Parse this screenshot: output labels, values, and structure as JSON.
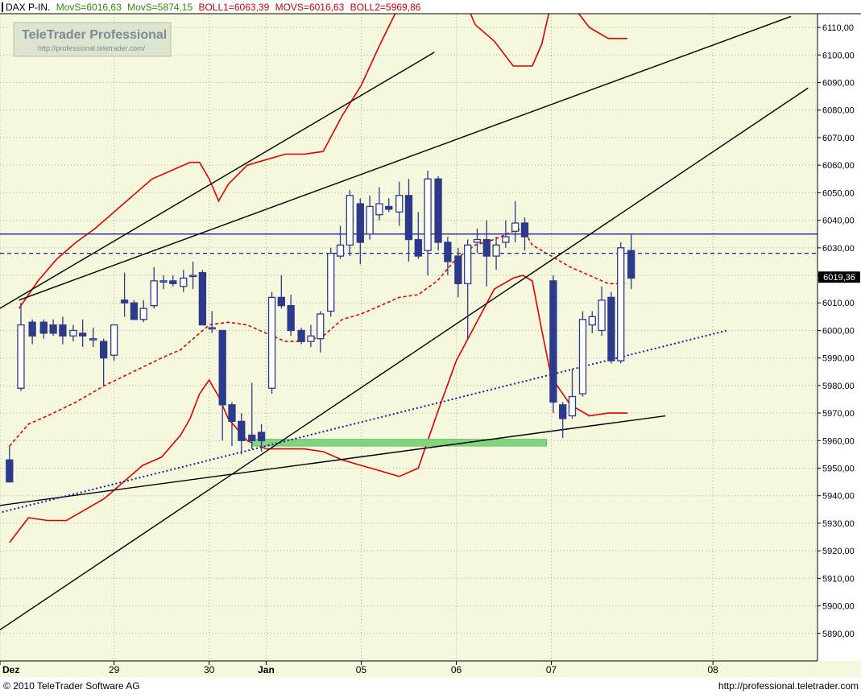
{
  "header": {
    "symbol": "DAX P-IN.",
    "movs_fast": "MovS=6016,63",
    "movs_slow": "MovS=5874,15",
    "boll1": "BOLL1=6063,39",
    "movs_mid": "MOVS=6016,63",
    "boll2": "BOLL2=5969,86"
  },
  "watermark": {
    "title": "TeleTrader Professional",
    "url": "http://professional.teletrader.com/"
  },
  "footer": {
    "copyright": "© 2010 TeleTrader Software AG",
    "url": "http://professional.teletrader.com"
  },
  "colors": {
    "background": "#f5f8dc",
    "grid": "#aab0a0",
    "candle": "#2d3a8c",
    "bollinger": "#e00000",
    "horizontal_level": "#1a1aa8",
    "support_zone": "#7fd67f",
    "trendline": "#000000",
    "title_green": "#2e8b00",
    "title_red": "#cc0000"
  },
  "chart_data": {
    "type": "candlestick",
    "y_axis": {
      "min": 5880,
      "max": 6115,
      "ticks": [
        5890,
        5900,
        5910,
        5920,
        5930,
        5940,
        5950,
        5960,
        5970,
        5980,
        5990,
        6000,
        6010,
        6020,
        6030,
        6040,
        6050,
        6060,
        6070,
        6080,
        6090,
        6100,
        6110
      ],
      "tick_labels": [
        "5890,00",
        "5900,00",
        "5910,00",
        "5920,00",
        "5930,00",
        "5940,00",
        "5950,00",
        "5960,00",
        "5970,00",
        "5980,00",
        "5990,00",
        "6000,00",
        "6010,00",
        "6020,00",
        "6030,00",
        "6040,00",
        "6050,00",
        "6060,00",
        "6070,00",
        "6080,00",
        "6090,00",
        "6100,00",
        "6110,00"
      ],
      "last_price_label": "6019,36",
      "last_price": 6019.36
    },
    "x_axis": {
      "bar_min": 0,
      "bar_max": 86,
      "ticks": [
        {
          "bar": 0,
          "label": "Dez"
        },
        {
          "bar": 12,
          "label": "29"
        },
        {
          "bar": 22,
          "label": "30"
        },
        {
          "bar": 28,
          "label": "Jan"
        },
        {
          "bar": 38,
          "label": "05"
        },
        {
          "bar": 48,
          "label": "06"
        },
        {
          "bar": 58,
          "label": "07"
        },
        {
          "bar": 75,
          "label": "08"
        }
      ]
    },
    "grid": true,
    "candles": [
      {
        "x": 1,
        "o": 5953,
        "h": 5958,
        "l": 5945,
        "c": 5945
      },
      {
        "x": 2.2,
        "o": 5979,
        "h": 6010,
        "l": 5978,
        "c": 6002
      },
      {
        "x": 3.4,
        "o": 6003,
        "h": 6004,
        "l": 5995,
        "c": 5998
      },
      {
        "x": 4.6,
        "o": 6003,
        "h": 6004,
        "l": 5997,
        "c": 5999
      },
      {
        "x": 5.6,
        "o": 6002,
        "h": 6004,
        "l": 5998,
        "c": 5999
      },
      {
        "x": 6.6,
        "o": 6002,
        "h": 6005,
        "l": 5995,
        "c": 5998
      },
      {
        "x": 7.7,
        "o": 5998,
        "h": 6002,
        "l": 5996,
        "c": 6000
      },
      {
        "x": 8.7,
        "o": 5999,
        "h": 6004,
        "l": 5994,
        "c": 5998
      },
      {
        "x": 9.8,
        "o": 5997,
        "h": 6001,
        "l": 5994,
        "c": 5997
      },
      {
        "x": 10.9,
        "o": 5996,
        "h": 5997,
        "l": 5980,
        "c": 5990
      },
      {
        "x": 12,
        "o": 5991,
        "h": 6002,
        "l": 5989,
        "c": 6002
      },
      {
        "x": 13.1,
        "o": 6011,
        "h": 6021,
        "l": 6005,
        "c": 6010
      },
      {
        "x": 14.1,
        "o": 6010,
        "h": 6011,
        "l": 6004,
        "c": 6004
      },
      {
        "x": 15.1,
        "o": 6004,
        "h": 6011,
        "l": 6003,
        "c": 6008
      },
      {
        "x": 16.2,
        "o": 6009,
        "h": 6023,
        "l": 6008,
        "c": 6018
      },
      {
        "x": 17.2,
        "o": 6018,
        "h": 6020,
        "l": 6015,
        "c": 6018
      },
      {
        "x": 18.2,
        "o": 6018,
        "h": 6020,
        "l": 6016,
        "c": 6017
      },
      {
        "x": 19.3,
        "o": 6016,
        "h": 6022,
        "l": 6014,
        "c": 6019
      },
      {
        "x": 20.3,
        "o": 6020,
        "h": 6025,
        "l": 6015,
        "c": 6020
      },
      {
        "x": 21.3,
        "o": 6021,
        "h": 6022,
        "l": 6002,
        "c": 6002
      },
      {
        "x": 22.3,
        "o": 6001,
        "h": 6007,
        "l": 5999,
        "c": 6001
      },
      {
        "x": 23.4,
        "o": 6000,
        "h": 6000,
        "l": 5960,
        "c": 5973
      },
      {
        "x": 24.4,
        "o": 5973,
        "h": 5974,
        "l": 5958,
        "c": 5967
      },
      {
        "x": 25.4,
        "o": 5967,
        "h": 5970,
        "l": 5955,
        "c": 5960
      },
      {
        "x": 26.5,
        "o": 5962,
        "h": 5981,
        "l": 5957,
        "c": 5960
      },
      {
        "x": 27.5,
        "o": 5963,
        "h": 5966,
        "l": 5956,
        "c": 5960
      },
      {
        "x": 28.6,
        "o": 5979,
        "h": 6014,
        "l": 5977,
        "c": 6012
      },
      {
        "x": 29.6,
        "o": 6012,
        "h": 6020,
        "l": 6008,
        "c": 6009
      },
      {
        "x": 30.6,
        "o": 6009,
        "h": 6013,
        "l": 5998,
        "c": 6000
      },
      {
        "x": 31.7,
        "o": 6000,
        "h": 6001,
        "l": 5995,
        "c": 5996
      },
      {
        "x": 32.7,
        "o": 5996,
        "h": 6002,
        "l": 5994,
        "c": 5998
      },
      {
        "x": 33.7,
        "o": 5997,
        "h": 6007,
        "l": 5992,
        "c": 6006
      },
      {
        "x": 34.8,
        "o": 6007,
        "h": 6030,
        "l": 6005,
        "c": 6028
      },
      {
        "x": 35.8,
        "o": 6027,
        "h": 6038,
        "l": 6026,
        "c": 6031
      },
      {
        "x": 36.8,
        "o": 6031,
        "h": 6051,
        "l": 6027,
        "c": 6049
      },
      {
        "x": 37.9,
        "o": 6046,
        "h": 6048,
        "l": 6024,
        "c": 6032
      },
      {
        "x": 38.9,
        "o": 6035,
        "h": 6049,
        "l": 6033,
        "c": 6045
      },
      {
        "x": 39.9,
        "o": 6042,
        "h": 6052,
        "l": 6040,
        "c": 6046
      },
      {
        "x": 40.9,
        "o": 6045,
        "h": 6048,
        "l": 6043,
        "c": 6044
      },
      {
        "x": 42,
        "o": 6043,
        "h": 6054,
        "l": 6038,
        "c": 6049
      },
      {
        "x": 43,
        "o": 6049,
        "h": 6055,
        "l": 6025,
        "c": 6033
      },
      {
        "x": 44,
        "o": 6033,
        "h": 6043,
        "l": 6026,
        "c": 6027
      },
      {
        "x": 45,
        "o": 6029,
        "h": 6058,
        "l": 6020,
        "c": 6055
      },
      {
        "x": 46.1,
        "o": 6055,
        "h": 6056,
        "l": 6029,
        "c": 6032
      },
      {
        "x": 47.1,
        "o": 6032,
        "h": 6034,
        "l": 6020,
        "c": 6025
      },
      {
        "x": 48.2,
        "o": 6027,
        "h": 6030,
        "l": 6012,
        "c": 6017
      },
      {
        "x": 49.2,
        "o": 6017,
        "h": 6033,
        "l": 5997,
        "c": 6031
      },
      {
        "x": 50.2,
        "o": 6032,
        "h": 6037,
        "l": 6028,
        "c": 6033
      },
      {
        "x": 51.2,
        "o": 6033,
        "h": 6040,
        "l": 6016,
        "c": 6027
      },
      {
        "x": 52.2,
        "o": 6027,
        "h": 6034,
        "l": 6022,
        "c": 6031
      },
      {
        "x": 53.2,
        "o": 6032,
        "h": 6040,
        "l": 6030,
        "c": 6034
      },
      {
        "x": 54.2,
        "o": 6036,
        "h": 6047,
        "l": 6032,
        "c": 6039
      },
      {
        "x": 55.2,
        "o": 6039,
        "h": 6041,
        "l": 6029,
        "c": 6034
      },
      {
        "x": 58.2,
        "o": 6018,
        "h": 6020,
        "l": 5970,
        "c": 5974
      },
      {
        "x": 59.2,
        "o": 5973,
        "h": 5974,
        "l": 5961,
        "c": 5968
      },
      {
        "x": 60.2,
        "o": 5969,
        "h": 5986,
        "l": 5968,
        "c": 5976
      },
      {
        "x": 61.3,
        "o": 5977,
        "h": 6007,
        "l": 5976,
        "c": 6004
      },
      {
        "x": 62.3,
        "o": 6002,
        "h": 6007,
        "l": 5999,
        "c": 6005
      },
      {
        "x": 63.3,
        "o": 6000,
        "h": 6016,
        "l": 5998,
        "c": 6011
      },
      {
        "x": 64.3,
        "o": 6012,
        "h": 6014,
        "l": 5988,
        "c": 5989
      },
      {
        "x": 65.3,
        "o": 5989,
        "h": 6032,
        "l": 5988,
        "c": 6030
      },
      {
        "x": 66.4,
        "o": 6029,
        "h": 6035,
        "l": 6015,
        "c": 6019
      }
    ],
    "horizontal_lines": [
      {
        "y": 6035,
        "style": "solid"
      },
      {
        "y": 6028,
        "style": "dashed"
      }
    ],
    "support_zone": {
      "x0": 26.5,
      "x1": 57.5,
      "y0": 5958,
      "y1": 5960.5
    },
    "trendlines": [
      {
        "x0": -1,
        "y0": 6006,
        "x1": 45.7,
        "y1": 6101,
        "style": "solid"
      },
      {
        "x0": 2,
        "y0": 6011,
        "x1": 83.2,
        "y1": 6114,
        "style": "solid"
      },
      {
        "x0": -1,
        "y0": 5889,
        "x1": 85,
        "y1": 6088,
        "style": "solid"
      },
      {
        "x0": -1,
        "y0": 5936,
        "x1": 70,
        "y1": 5969,
        "style": "solid"
      },
      {
        "x0": -1,
        "y0": 5933,
        "x1": 76.5,
        "y1": 6000,
        "style": "dotted"
      }
    ],
    "series": [
      {
        "role": "boll_upper",
        "style": "solid",
        "points": [
          [
            2,
            6008
          ],
          [
            4,
            6018
          ],
          [
            6,
            6026
          ],
          [
            8,
            6032
          ],
          [
            10,
            6037
          ],
          [
            12,
            6043
          ],
          [
            14,
            6049
          ],
          [
            16,
            6055
          ],
          [
            18,
            6058
          ],
          [
            20,
            6061
          ],
          [
            21,
            6061
          ],
          [
            22,
            6055
          ],
          [
            23,
            6047
          ],
          [
            24,
            6053
          ],
          [
            26,
            6060
          ],
          [
            28,
            6062
          ],
          [
            30,
            6064
          ],
          [
            32,
            6064
          ],
          [
            34,
            6065
          ],
          [
            36,
            6078
          ],
          [
            38,
            6089
          ],
          [
            40,
            6104
          ],
          [
            42,
            6118
          ],
          [
            44,
            6132
          ],
          [
            46,
            6138
          ],
          [
            48,
            6127
          ],
          [
            50,
            6111
          ],
          [
            52,
            6105
          ],
          [
            54,
            6096
          ],
          [
            56,
            6096
          ],
          [
            57,
            6104
          ],
          [
            58,
            6119
          ],
          [
            60,
            6119
          ],
          [
            62,
            6110
          ],
          [
            64,
            6106
          ],
          [
            66,
            6106
          ]
        ]
      },
      {
        "role": "boll_lower",
        "style": "solid",
        "points": [
          [
            1,
            5923
          ],
          [
            3,
            5932
          ],
          [
            5,
            5931
          ],
          [
            7,
            5931
          ],
          [
            9,
            5935
          ],
          [
            11,
            5939
          ],
          [
            13,
            5945
          ],
          [
            15,
            5951
          ],
          [
            17,
            5954
          ],
          [
            19,
            5962
          ],
          [
            20,
            5968
          ],
          [
            21,
            5977
          ],
          [
            22,
            5982
          ],
          [
            23,
            5976
          ],
          [
            24,
            5968
          ],
          [
            26,
            5960
          ],
          [
            28,
            5957
          ],
          [
            30,
            5957
          ],
          [
            32,
            5957
          ],
          [
            34,
            5956
          ],
          [
            36,
            5953
          ],
          [
            38,
            5951
          ],
          [
            40,
            5949
          ],
          [
            42,
            5947
          ],
          [
            44,
            5950
          ],
          [
            46,
            5970
          ],
          [
            48,
            5989
          ],
          [
            50,
            6002
          ],
          [
            52,
            6015
          ],
          [
            54,
            6019
          ],
          [
            55,
            6020
          ],
          [
            56,
            6018
          ],
          [
            57,
            6000
          ],
          [
            58,
            5983
          ],
          [
            60,
            5973
          ],
          [
            62,
            5969
          ],
          [
            64,
            5970
          ],
          [
            66,
            5970
          ]
        ]
      },
      {
        "role": "boll_middle",
        "style": "dashed",
        "points": [
          [
            1,
            5958
          ],
          [
            3,
            5966
          ],
          [
            5,
            5969
          ],
          [
            8,
            5974
          ],
          [
            11,
            5980
          ],
          [
            14,
            5985
          ],
          [
            17,
            5990
          ],
          [
            19,
            5993
          ],
          [
            21,
            5999
          ],
          [
            22,
            6002
          ],
          [
            24,
            6003
          ],
          [
            26,
            6002
          ],
          [
            28,
            5999
          ],
          [
            30,
            5996
          ],
          [
            32,
            5996
          ],
          [
            34,
            5998
          ],
          [
            36,
            6004
          ],
          [
            38,
            6006
          ],
          [
            40,
            6009
          ],
          [
            42,
            6012
          ],
          [
            44,
            6013
          ],
          [
            46,
            6018
          ],
          [
            48,
            6026
          ],
          [
            50,
            6031
          ],
          [
            52,
            6033
          ],
          [
            54,
            6036
          ],
          [
            55,
            6037
          ],
          [
            56,
            6031
          ],
          [
            58,
            6027
          ],
          [
            60,
            6023
          ],
          [
            62,
            6020
          ],
          [
            64,
            6017
          ],
          [
            66,
            6017
          ]
        ]
      }
    ]
  }
}
